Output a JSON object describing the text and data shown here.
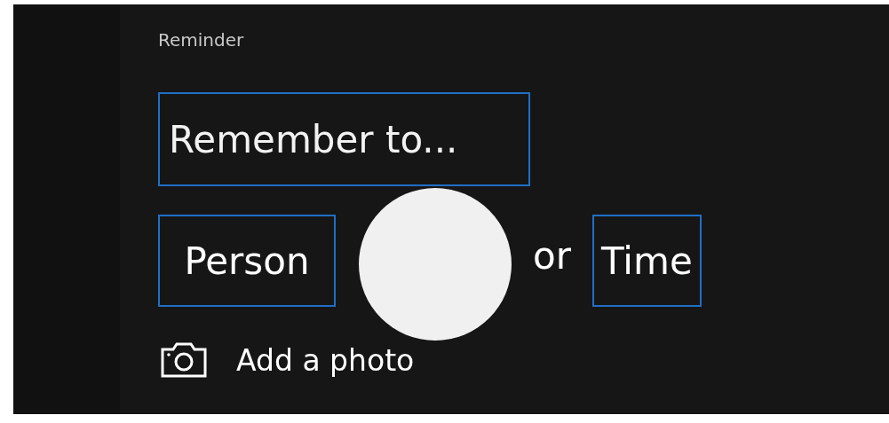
{
  "section": {
    "title": "Reminder"
  },
  "reminder_field": {
    "placeholder": "Remember to..."
  },
  "trigger_row": [
    {
      "kind": "field",
      "label": "Person"
    },
    {
      "kind": "text",
      "label": "or"
    },
    {
      "kind": "field",
      "label": "Time"
    }
  ],
  "photo": {
    "label": "Add a photo"
  }
}
